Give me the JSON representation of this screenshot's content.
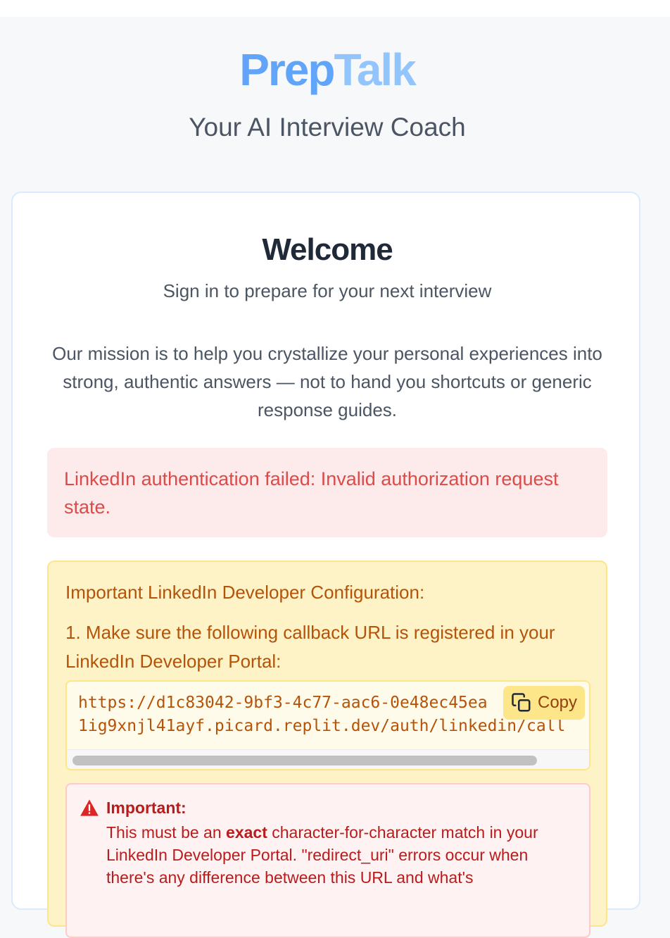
{
  "brand": {
    "part1": "Prep",
    "part2": "Talk"
  },
  "tagline": "Your AI Interview Coach",
  "card": {
    "title": "Welcome",
    "subtitle": "Sign in to prepare for your next interview",
    "mission": "Our mission is to help you crystallize your personal experiences into strong, authentic answers — not to hand you shortcuts or generic response guides."
  },
  "error": {
    "message": "LinkedIn authentication failed: Invalid authorization request state."
  },
  "config": {
    "title": "Important LinkedIn Developer Configuration:",
    "step1": "1. Make sure the following callback URL is registered in your LinkedIn Developer Portal:",
    "callback_url_line1": "https://d1c83042-9bf3-4c77-aac6-0e48ec45ea",
    "callback_url_line2": "1ig9xnjl41ayf.picard.replit.dev/auth/linkedin/call",
    "copy_label": "Copy"
  },
  "important": {
    "title": "Important:",
    "body_prefix": "This must be an ",
    "body_emphasis": "exact",
    "body_suffix": " character-for-character match in your LinkedIn Developer Portal. \"redirect_uri\" errors occur when there's any difference between this URL and what's"
  },
  "colors": {
    "brand_primary": "#60a5fa",
    "brand_secondary": "#93c5fd",
    "error_text": "#dc4a4a",
    "warning_text": "#b45309",
    "important_text": "#b91c1c"
  }
}
